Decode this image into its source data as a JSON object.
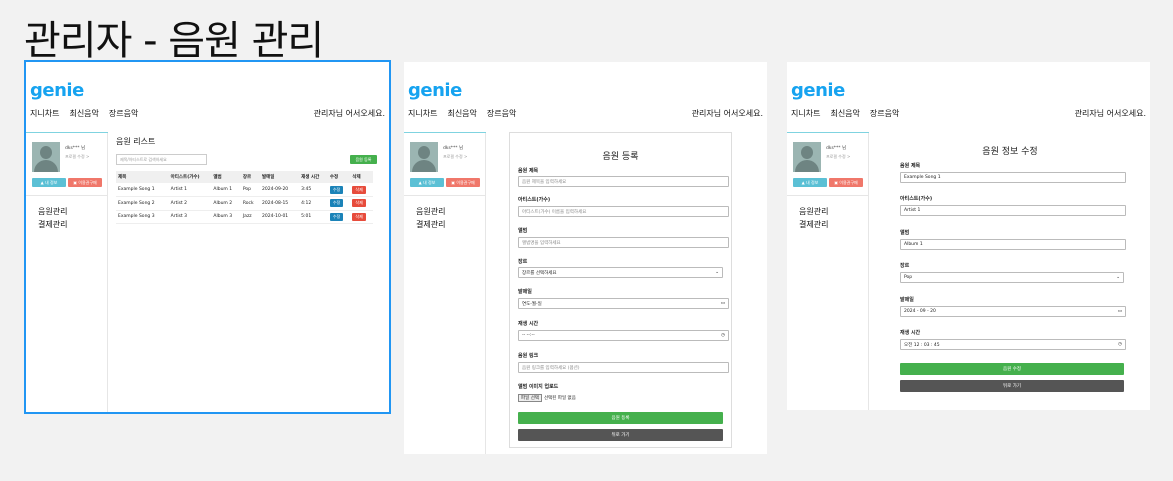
{
  "page_title": "관리자 - 음원 관리",
  "common": {
    "logo": "genie",
    "nav": [
      "지니차트",
      "최신음악",
      "장르음악"
    ],
    "welcome": "관리자님 어서오세요.",
    "user_name": "dks*** 님",
    "profile_edit": "프로필 수정 >",
    "btn_my_info": "▲ 내 정보",
    "btn_cart": "▣ 이용권구매",
    "menu": [
      "음원관리",
      "결제관리"
    ]
  },
  "list_page": {
    "title": "음원 리스트",
    "search_placeholder": "제목/아티스트로 검색하세요",
    "add_button": "음원 등록",
    "columns": [
      "제목",
      "아티스트(가수)",
      "앨범",
      "장르",
      "발매일",
      "재생 시간",
      "수정",
      "삭제"
    ],
    "rows": [
      [
        "Example Song 1",
        "Artist 1",
        "Album 1",
        "Pop",
        "2024-09-20",
        "3:45",
        "수정",
        "삭제"
      ],
      [
        "Example Song 2",
        "Artist 2",
        "Album 2",
        "Rock",
        "2024-08-15",
        "4:12",
        "수정",
        "삭제"
      ],
      [
        "Example Song 3",
        "Artist 3",
        "Album 3",
        "Jazz",
        "2024-10-01",
        "5:01",
        "수정",
        "삭제"
      ]
    ]
  },
  "register_page": {
    "title": "음원 등록",
    "fields": [
      {
        "label": "음원 제목",
        "placeholder": "음원 제목을 입력하세요"
      },
      {
        "label": "아티스트(가수)",
        "placeholder": "아티스트(가수) 이름을 입력하세요"
      },
      {
        "label": "앨범",
        "placeholder": "앨범명을 입력하세요"
      },
      {
        "label": "장르",
        "placeholder": "장르를 선택하세요"
      },
      {
        "label": "발매일",
        "placeholder": "연도-월-일"
      },
      {
        "label": "재생 시간",
        "placeholder": "-- --:--"
      },
      {
        "label": "음원 링크",
        "placeholder": "음원 링크를 입력하세요 (옵션)"
      }
    ],
    "image_label": "앨범 이미지 업로드",
    "file_button": "파일 선택",
    "file_status": "선택된 파일 없음",
    "submit": "음원 등록",
    "back": "뒤로 가기"
  },
  "edit_page": {
    "title": "음원 정보 수정",
    "fields": [
      {
        "label": "음원 제목",
        "value": "Example Song 1"
      },
      {
        "label": "아티스트(가수)",
        "value": "Artist 1"
      },
      {
        "label": "앨범",
        "value": "Album 1"
      },
      {
        "label": "장르",
        "value": "Pop"
      },
      {
        "label": "발매일",
        "value": "2024 - 09 - 20"
      },
      {
        "label": "재생 시간",
        "value": "오전 12 : 03 : 45"
      }
    ],
    "submit": "음원 수정",
    "back": "뒤로 가기"
  }
}
